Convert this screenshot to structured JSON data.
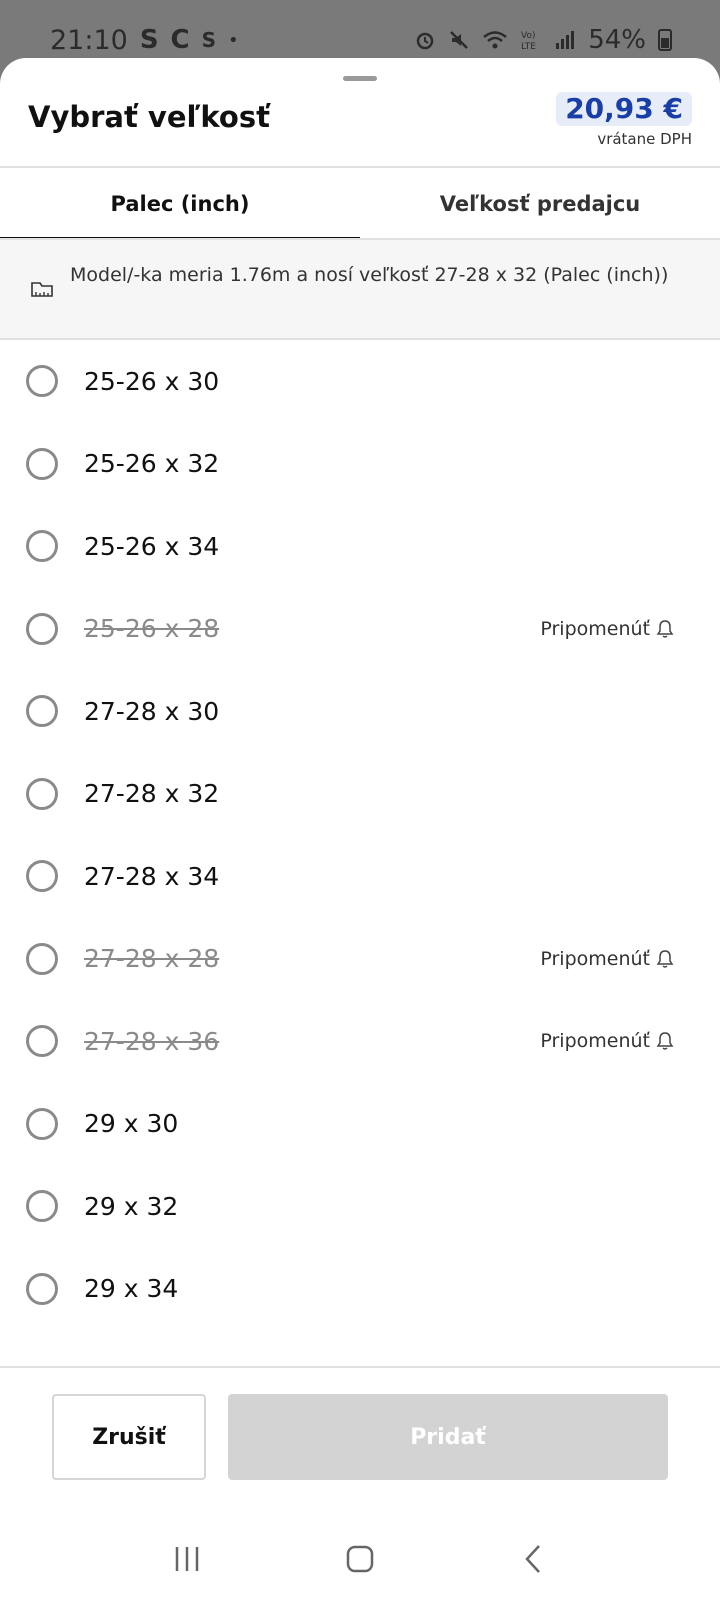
{
  "status_bar": {
    "time": "21:10",
    "left_icons": [
      "S",
      "C",
      "S",
      "•"
    ],
    "battery": "54%"
  },
  "header": {
    "title": "Vybrať veľkosť",
    "price": "20,93 €",
    "vat_note": "vrátane DPH"
  },
  "tabs": [
    {
      "label": "Palec (inch)",
      "active": true
    },
    {
      "label": "Veľkosť predajcu",
      "active": false
    }
  ],
  "info_banner": {
    "icon": "ruler-icon",
    "text": "Model/-ka meria 1.76m a nosí veľkosť 27-28 x 32 (Palec (inch))"
  },
  "sizes": [
    {
      "label": "25-26 x 30",
      "available": true
    },
    {
      "label": "25-26 x 32",
      "available": true
    },
    {
      "label": "25-26 x 34",
      "available": true
    },
    {
      "label": "25-26 x 28",
      "available": false,
      "remind_label": "Pripomenúť"
    },
    {
      "label": "27-28 x 30",
      "available": true
    },
    {
      "label": "27-28 x 32",
      "available": true
    },
    {
      "label": "27-28 x 34",
      "available": true
    },
    {
      "label": "27-28 x 28",
      "available": false,
      "remind_label": "Pripomenúť"
    },
    {
      "label": "27-28 x 36",
      "available": false,
      "remind_label": "Pripomenúť"
    },
    {
      "label": "29 x 30",
      "available": true
    },
    {
      "label": "29 x 32",
      "available": true
    },
    {
      "label": "29 x 34",
      "available": true
    }
  ],
  "footer": {
    "cancel_label": "Zrušiť",
    "add_label": "Pridať"
  },
  "colors": {
    "price_text": "#1a3ea8",
    "price_bg": "#e6edf9",
    "disabled_button": "#d3d3d3"
  }
}
